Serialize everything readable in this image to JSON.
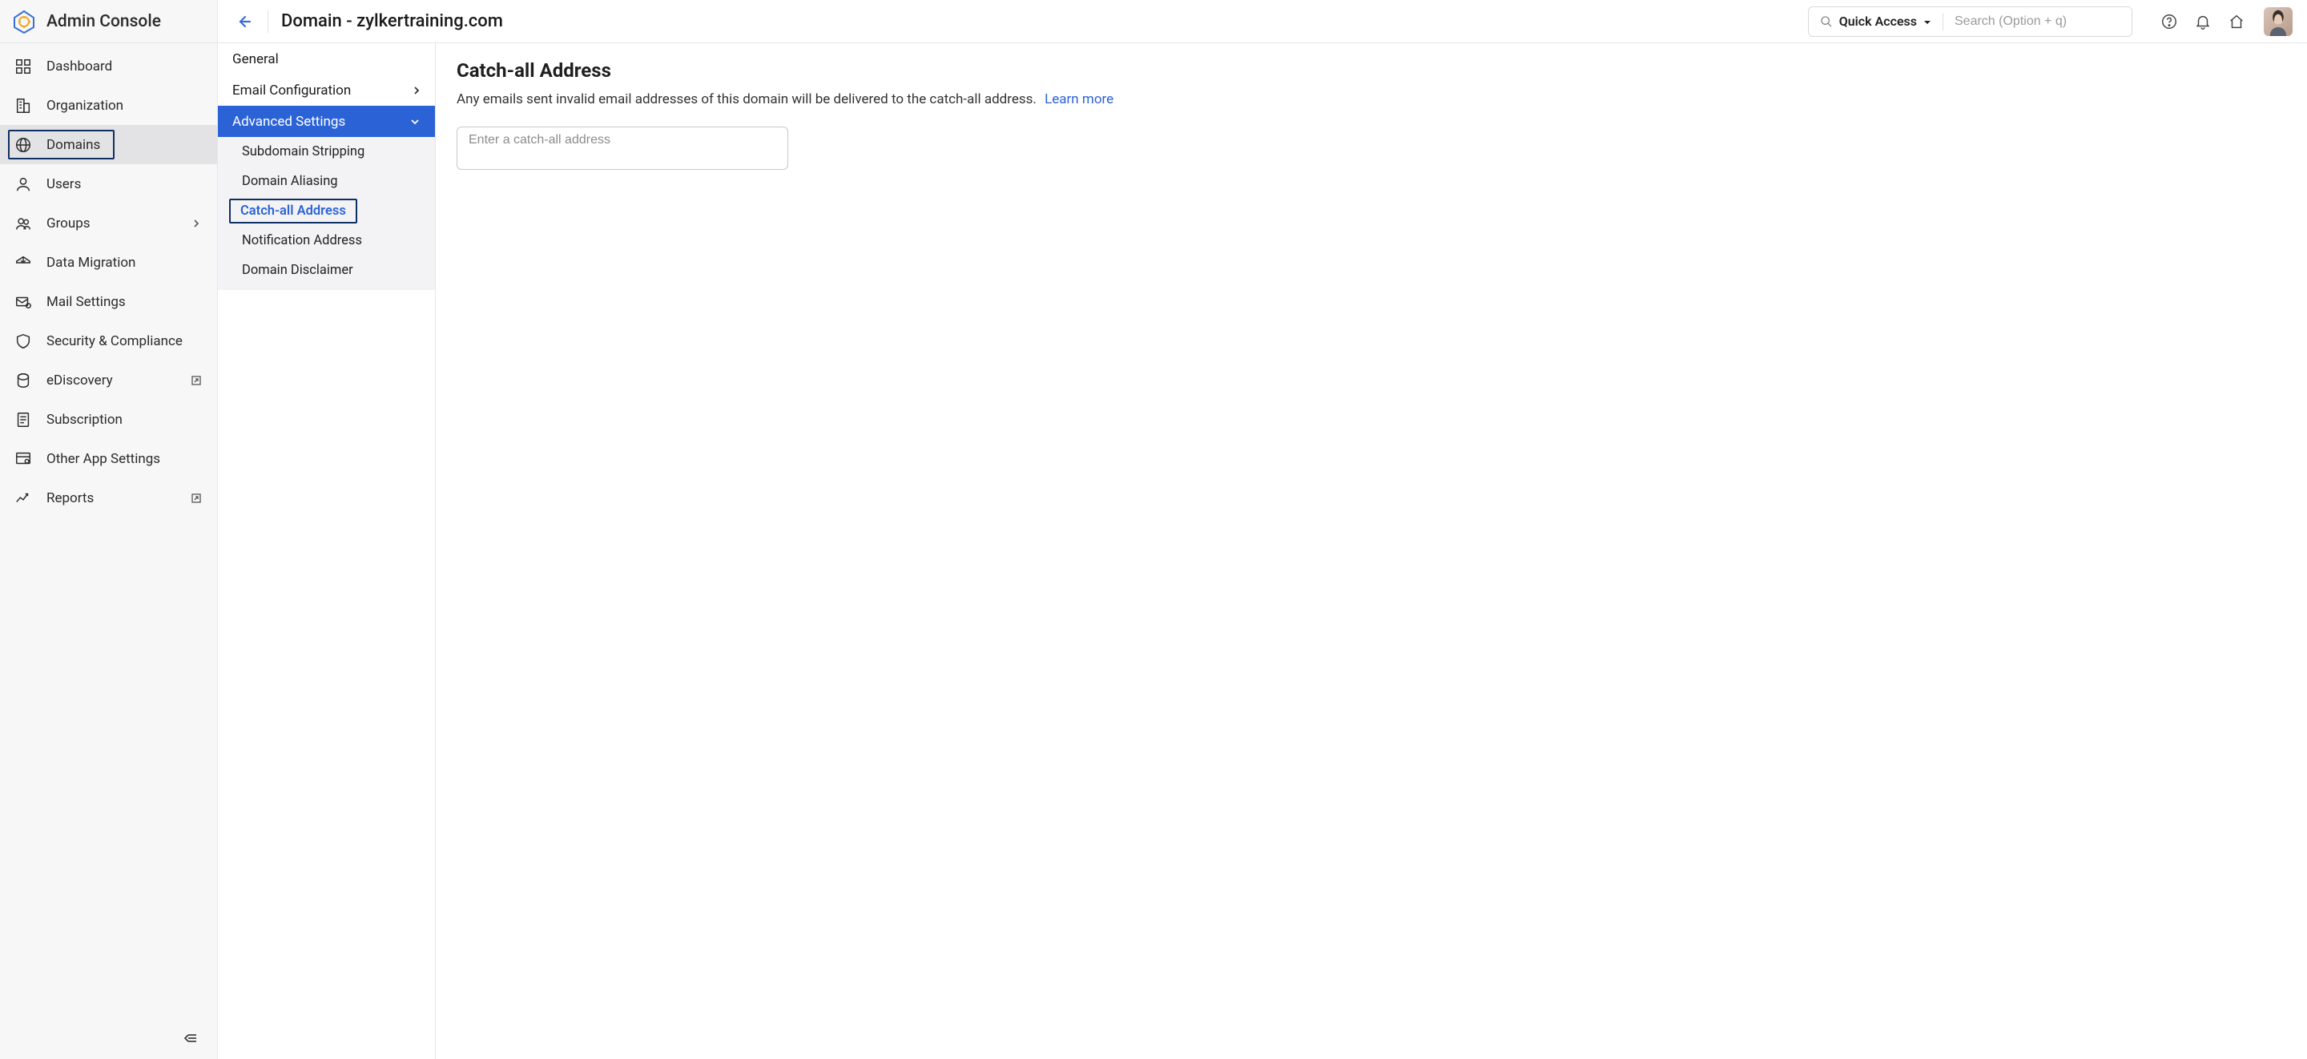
{
  "sidebar": {
    "title": "Admin Console",
    "items": [
      {
        "label": "Dashboard"
      },
      {
        "label": "Organization"
      },
      {
        "label": "Domains",
        "active": true
      },
      {
        "label": "Users"
      },
      {
        "label": "Groups",
        "chevron": true
      },
      {
        "label": "Data Migration"
      },
      {
        "label": "Mail Settings"
      },
      {
        "label": "Security & Compliance"
      },
      {
        "label": "eDiscovery",
        "external": true
      },
      {
        "label": "Subscription"
      },
      {
        "label": "Other App Settings"
      },
      {
        "label": "Reports",
        "external": true
      }
    ]
  },
  "header": {
    "title": "Domain - zylkertraining.com",
    "quick_access": "Quick Access",
    "search_placeholder": "Search (Option + q)"
  },
  "subnav": {
    "items": [
      {
        "label": "General"
      },
      {
        "label": "Email Configuration",
        "chevron": true
      },
      {
        "label": "Advanced Settings",
        "expanded": true,
        "children": [
          {
            "label": "Subdomain Stripping"
          },
          {
            "label": "Domain Aliasing"
          },
          {
            "label": "Catch-all Address",
            "active": true
          },
          {
            "label": "Notification Address"
          },
          {
            "label": "Domain Disclaimer"
          }
        ]
      }
    ]
  },
  "panel": {
    "heading": "Catch-all Address",
    "description": "Any emails sent invalid email addresses of this domain will be delivered to the catch-all address.",
    "learn_more": "Learn more",
    "input_placeholder": "Enter a catch-all address"
  }
}
